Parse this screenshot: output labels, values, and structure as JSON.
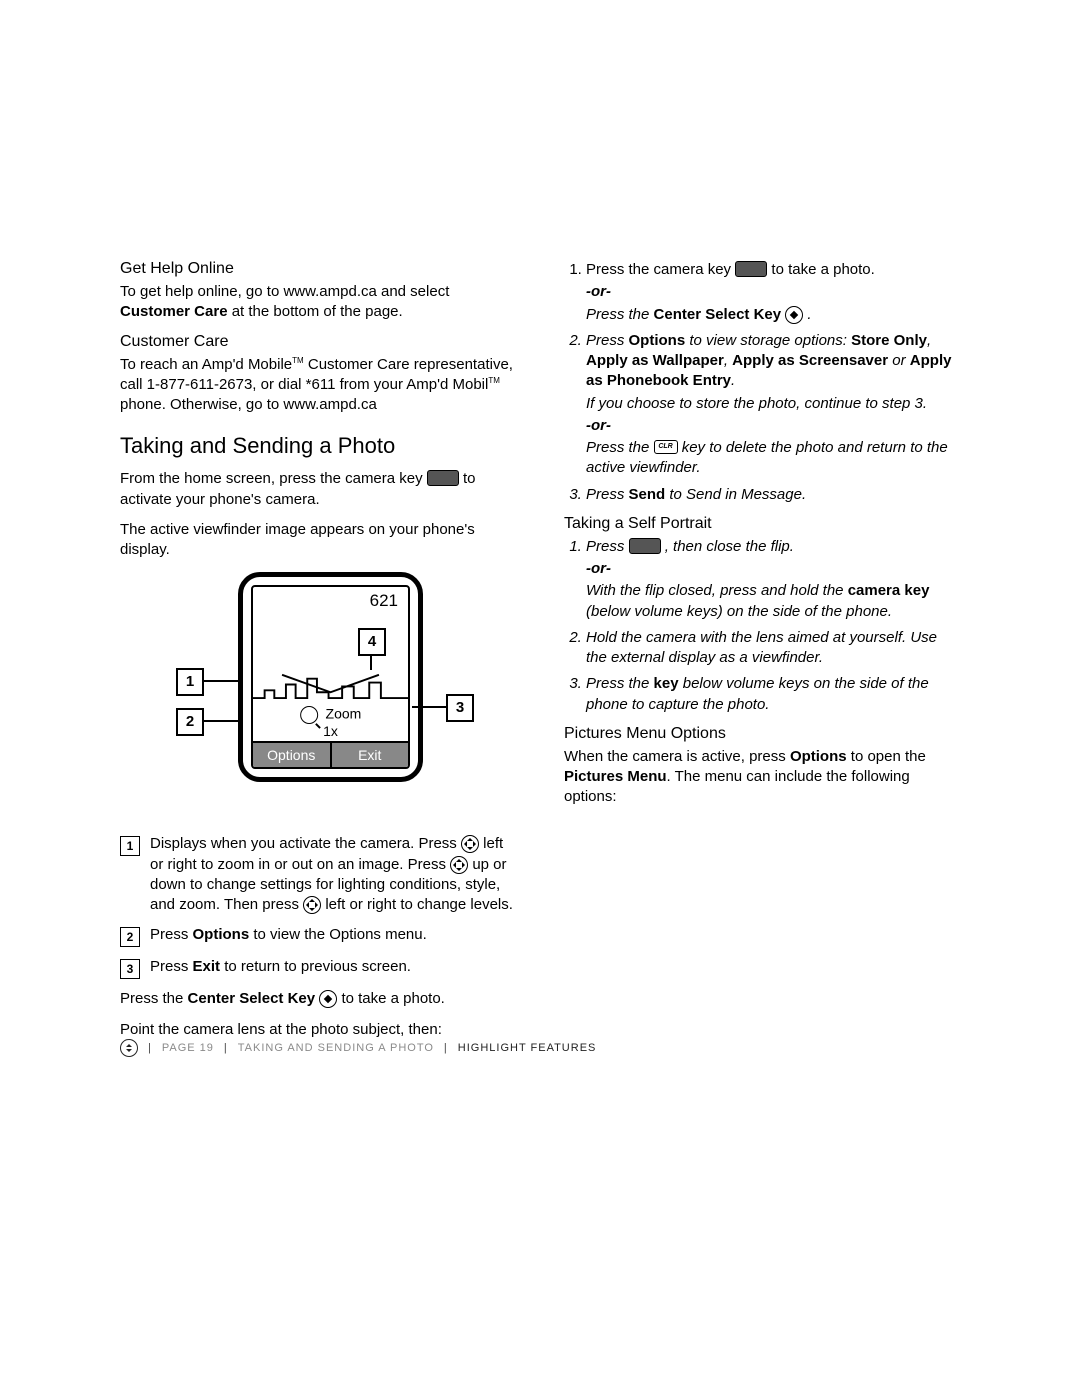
{
  "left": {
    "help_heading": "Get Help Online",
    "help_text_a": "To get help online, go to www.ampd.ca and select ",
    "help_text_b": "Customer Care",
    "help_text_c": " at the bottom of the page.",
    "care_heading": "Customer Care",
    "care_text_a": "To reach an Amp'd Mobile",
    "care_text_b": " Customer Care representative, call 1-877-611-2673, or dial *611 from your Amp'd Mobil",
    "care_text_c": " phone. Otherwise, go to www.ampd.ca",
    "section_heading": "Taking and Sending a Photo",
    "intro_a": "From the home screen, press the camera key ",
    "intro_b": " to activate your phone's camera.",
    "intro2": "The active viewfinder image appears on your phone's display.",
    "phone_count": "621",
    "zoom_label": "Zoom",
    "zoom_value": "1x",
    "soft_left": "Options",
    "soft_right": "Exit",
    "callout1": "1",
    "callout2": "2",
    "callout3": "3",
    "callout4": "4",
    "legend1_a": "Displays when you activate the camera. Press ",
    "legend1_b": " left or right to zoom in or out on an image. Press ",
    "legend1_c": " up or down to change settings for lighting conditions, style, and zoom. Then press ",
    "legend1_d": " left or right to change levels.",
    "legend2_a": "Press ",
    "legend2_b": "Options",
    "legend2_c": " to view the Options menu.",
    "legend3_a": "Press ",
    "legend3_b": "Exit",
    "legend3_c": " to return to previous screen.",
    "after1_a": "Press the ",
    "after1_b": "Center Select Key",
    "after1_c": "  to take a photo.",
    "after2": "Point the camera lens at the photo subject, then:"
  },
  "right": {
    "s1_a": "Press the camera key ",
    "s1_b": " to take a photo.",
    "or": "-or-",
    "s1_c": "Press the ",
    "s1_d": "Center Select Key",
    "s1_e": " .",
    "s2_a": "Press ",
    "s2_b": "Options",
    "s2_c": " to view storage options: ",
    "s2_d": "Store Only",
    "s2_e": ", ",
    "s2_f": "Apply as Wallpaper",
    "s2_g": ", ",
    "s2_h": "Apply as Screensaver",
    "s2_i": " or ",
    "s2_j": "Apply as Phonebook Entry",
    "s2_k": ".",
    "s2_note": "If you choose to store the photo, continue to step 3.",
    "s2_del_a": "Press the ",
    "s2_del_b": " key to delete the photo and return to the active viewfinder.",
    "s3_a": "Press ",
    "s3_b": "Send",
    "s3_c": " to Send in Message.",
    "self_heading": "Taking a Self Portrait",
    "sp1_a": "Press ",
    "sp1_b": ", then close the flip.",
    "sp1_c": "With the flip closed, press and hold the ",
    "sp1_d": "camera key",
    "sp1_e": " (below volume keys) on the side of the phone.",
    "sp2": "Hold the camera with the lens aimed at yourself. Use the external display as a viewfinder.",
    "sp3_a": "Press the ",
    "sp3_b": "key",
    "sp3_c": " below volume keys on the side of the phone to capture the photo.",
    "pm_heading": "Pictures Menu Options",
    "pm_a": "When the camera is active, press ",
    "pm_b": "Options",
    "pm_c": " to open the ",
    "pm_d": "Pictures Menu",
    "pm_e": ". The menu can include the following options:"
  },
  "footer": {
    "page": "PAGE 19",
    "mid": "TAKING AND SENDING A PHOTO",
    "end": "HIGHLIGHT FEATURES",
    "clr": "CLR",
    "tm": "TM"
  }
}
